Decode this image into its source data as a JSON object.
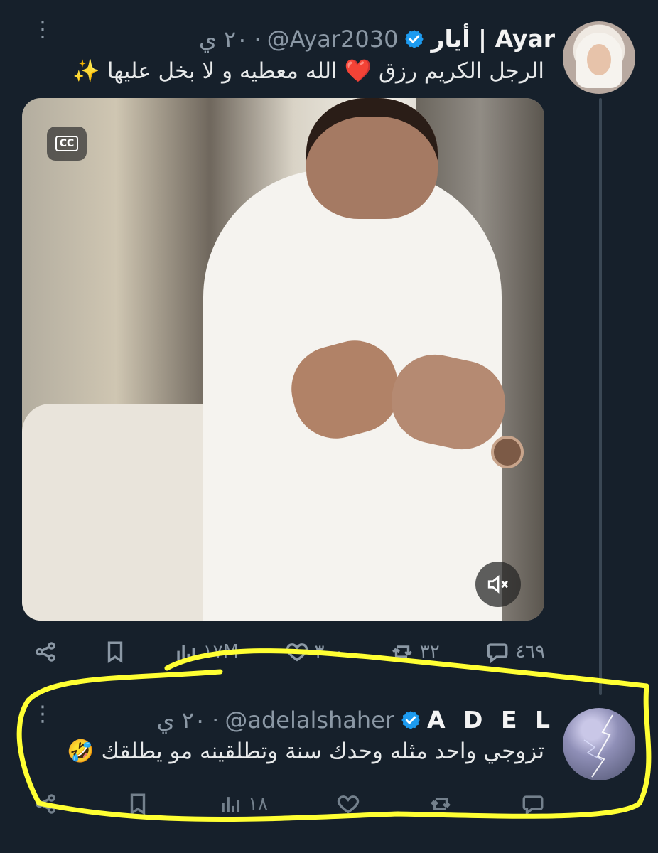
{
  "tweet": {
    "author_name": "أيار | Ayar",
    "handle": "@Ayar2030",
    "separator": "·",
    "time": "٢٠ ي",
    "text": "الرجل الكريم رزق ❤️ الله معطيه و لا بخل عليها ✨",
    "media": {
      "cc_label": "CC"
    },
    "actions": {
      "replies": "٤٦٩",
      "retweets": "٣٢",
      "likes": "٣٠٠",
      "views": "١٧M"
    }
  },
  "reply": {
    "author_name": "A D E L",
    "handle": "@adelalshaher",
    "separator": "·",
    "time": "٢٠ ي",
    "text": "تزوجي واحد مثله وحدك سنة وتطلقينه مو يطلقك 🤣",
    "actions": {
      "views": "١٨"
    }
  },
  "colors": {
    "background": "#16202b",
    "text": "#e7e9ea",
    "muted": "#8b98a5",
    "verified": "#1d9bf0",
    "highlight": "#ffff33"
  },
  "icons": [
    "more-icon",
    "verified-icon",
    "cc-icon",
    "mute-icon",
    "share-icon",
    "bookmark-icon",
    "views-icon",
    "like-icon",
    "retweet-icon",
    "reply-icon"
  ]
}
